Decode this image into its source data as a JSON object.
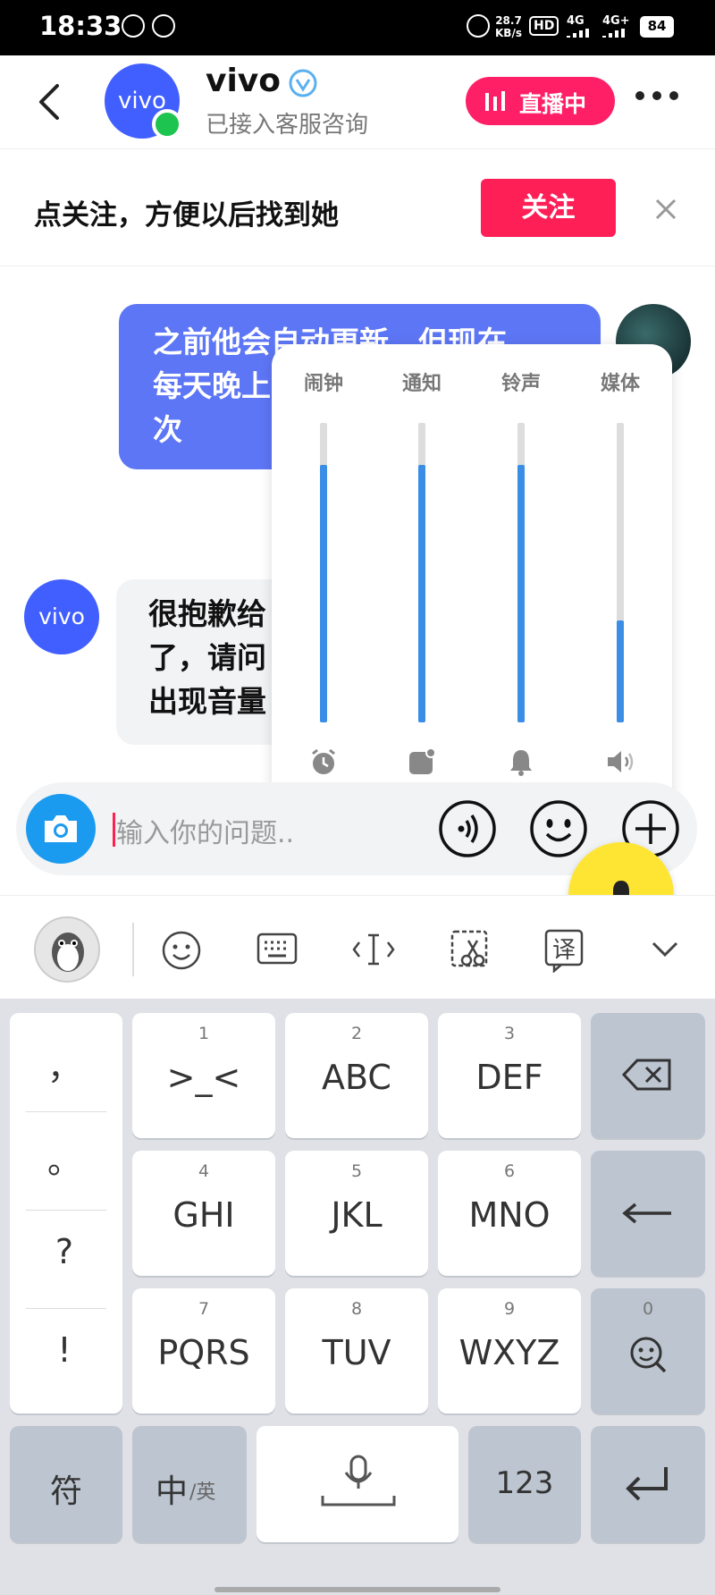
{
  "status_bar": {
    "time": "18:33",
    "net_speed_value": "28.7",
    "net_speed_unit": "KB/s",
    "hd_label": "HD",
    "sim1_label": "4G",
    "sim2_label": "4G+",
    "battery": "84"
  },
  "header": {
    "name": "vivo",
    "subtitle": "已接入客服咨询",
    "avatar_text": "vivo",
    "live_label": "直播中"
  },
  "follow_bar": {
    "text": "点关注，方便以后找到她",
    "button": "关注"
  },
  "messages": [
    {
      "sender": "user",
      "lines": [
        "之前他会自动更新，但现在",
        "每天晚上",
        "次"
      ]
    },
    {
      "sender": "vivo",
      "avatar_text": "vivo",
      "lines": [
        "很抱歉给",
        "了，请问",
        "出现音量"
      ]
    }
  ],
  "volume_panel": {
    "channels": [
      {
        "label": "闹钟",
        "level": 0.86,
        "icon": "alarm-clock-icon"
      },
      {
        "label": "通知",
        "level": 0.86,
        "icon": "notification-icon"
      },
      {
        "label": "铃声",
        "level": 0.86,
        "icon": "bell-icon"
      },
      {
        "label": "媒体",
        "level": 0.34,
        "icon": "speaker-icon"
      }
    ],
    "accent_color": "#3a8ee6"
  },
  "input": {
    "placeholder": "输入你的问题.."
  },
  "keyboard": {
    "side_keys": [
      "，",
      "。",
      "?",
      "!"
    ],
    "keys": [
      {
        "num": "1",
        "label": ">_<"
      },
      {
        "num": "2",
        "label": "ABC"
      },
      {
        "num": "3",
        "label": "DEF"
      },
      {
        "num": "4",
        "label": "GHI"
      },
      {
        "num": "5",
        "label": "JKL"
      },
      {
        "num": "6",
        "label": "MNO"
      },
      {
        "num": "7",
        "label": "PQRS"
      },
      {
        "num": "8",
        "label": "TUV"
      },
      {
        "num": "9",
        "label": "WXYZ"
      }
    ],
    "zero_label": "0",
    "symbol_key": "符",
    "lang_main": "中",
    "lang_alt": "/英",
    "num_key": "123"
  }
}
